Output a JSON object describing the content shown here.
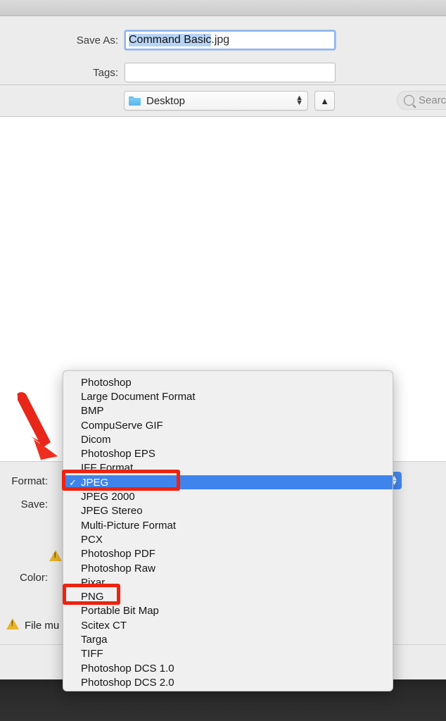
{
  "window": {
    "title": ""
  },
  "save_panel": {
    "save_as_label": "Save As:",
    "filename_selected": "Command Basic",
    "filename_extension": ".jpg",
    "tags_label": "Tags:",
    "tags_value": "",
    "tags_placeholder": ""
  },
  "pathbar": {
    "location_label": "Desktop",
    "folder_icon": "folder-icon",
    "updown_icon": "updown-chevron-icon",
    "back_up_icon": "chevron-up-icon",
    "search_placeholder": "Searc",
    "search_icon": "search-icon"
  },
  "options": {
    "format_label": "Format:",
    "save_label": "Save:",
    "color_label": "Color:",
    "file_must_text": "File mu",
    "warning_icon": "warning-triangle-icon"
  },
  "format_menu": {
    "selected_value": "JPEG",
    "check_glyph": "✓",
    "items": [
      {
        "label": "Photoshop",
        "selected": false
      },
      {
        "label": "Large Document Format",
        "selected": false
      },
      {
        "label": "BMP",
        "selected": false
      },
      {
        "label": "CompuServe GIF",
        "selected": false
      },
      {
        "label": "Dicom",
        "selected": false
      },
      {
        "label": "Photoshop EPS",
        "selected": false
      },
      {
        "label": "IFF Format",
        "selected": false
      },
      {
        "label": "JPEG",
        "selected": true
      },
      {
        "label": "JPEG 2000",
        "selected": false
      },
      {
        "label": "JPEG Stereo",
        "selected": false
      },
      {
        "label": "Multi-Picture Format",
        "selected": false
      },
      {
        "label": "PCX",
        "selected": false
      },
      {
        "label": "Photoshop PDF",
        "selected": false
      },
      {
        "label": "Photoshop Raw",
        "selected": false
      },
      {
        "label": "Pixar",
        "selected": false
      },
      {
        "label": "PNG",
        "selected": false
      },
      {
        "label": "Portable Bit Map",
        "selected": false
      },
      {
        "label": "Scitex CT",
        "selected": false
      },
      {
        "label": "Targa",
        "selected": false
      },
      {
        "label": "TIFF",
        "selected": false
      },
      {
        "label": "Photoshop DCS 1.0",
        "selected": false
      },
      {
        "label": "Photoshop DCS 2.0",
        "selected": false
      }
    ]
  },
  "annotations": {
    "arrow_color": "#ee2211",
    "box_color": "#ee2211",
    "highlight_targets": [
      "JPEG",
      "PNG"
    ],
    "arrow_points_to": "Format:"
  },
  "colors": {
    "selection_blue": "#3f84ec",
    "panel_gray": "#ececec",
    "menu_gray": "#f0f0f0",
    "text_selection_blue": "#b8d4f5",
    "warning_yellow": "#e8b428",
    "annotation_red": "#ee2211"
  }
}
